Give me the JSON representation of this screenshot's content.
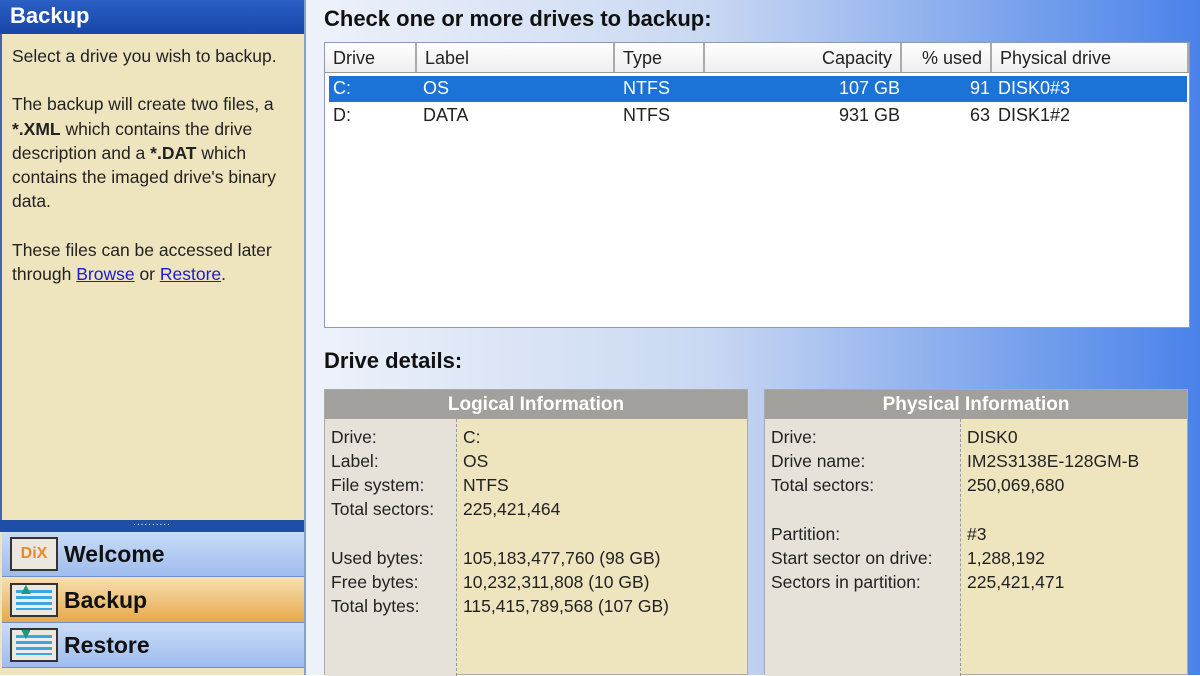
{
  "sidebar": {
    "title": "Backup",
    "text1": "Select a drive you wish to backup.",
    "text2_a": "The backup will create two files, a ",
    "text2_xml": "*.XML",
    "text2_b": " which contains the drive description and a ",
    "text2_dat": "*.DAT",
    "text2_c": " which contains the imaged drive's binary data.",
    "text3_a": "These files can be accessed later through ",
    "browse": "Browse",
    "or": " or ",
    "restore": "Restore",
    "text3_end": ".",
    "splitter": "..........",
    "nav": [
      {
        "label": "Welcome",
        "icon": "dix-logo-icon",
        "icon_text": "DiX"
      },
      {
        "label": "Backup",
        "icon": "backup-icon",
        "active": true
      },
      {
        "label": "Restore",
        "icon": "restore-icon"
      }
    ]
  },
  "main": {
    "heading": "Check one or more drives to backup:",
    "columns": [
      "Drive",
      "Label",
      "Type",
      "Capacity",
      "% used",
      "Physical drive"
    ],
    "rows": [
      [
        "C:",
        "OS",
        "NTFS",
        "107 GB",
        "91",
        "DISK0#3"
      ],
      [
        "D:",
        "DATA",
        "NTFS",
        "931 GB",
        "63",
        "DISK1#2"
      ]
    ],
    "details_heading": "Drive details:",
    "logical": {
      "title": "Logical Information",
      "items": [
        [
          "Drive:",
          "C:"
        ],
        [
          "Label:",
          "OS"
        ],
        [
          "File system:",
          "NTFS"
        ],
        [
          "Total sectors:",
          "225,421,464"
        ],
        [
          "Used bytes:",
          "105,183,477,760 (98 GB)"
        ],
        [
          "Free bytes:",
          "10,232,311,808 (10 GB)"
        ],
        [
          "Total bytes:",
          "115,415,789,568 (107 GB)"
        ]
      ]
    },
    "physical": {
      "title": "Physical Information",
      "items": [
        [
          "Drive:",
          "DISK0"
        ],
        [
          "Drive name:",
          "IM2S3138E-128GM-B"
        ],
        [
          "Total sectors:",
          "250,069,680"
        ],
        [
          "Partition:",
          "#3"
        ],
        [
          "Start sector on drive:",
          "1,288,192"
        ],
        [
          "Sectors in partition:",
          "225,421,471"
        ]
      ]
    }
  }
}
